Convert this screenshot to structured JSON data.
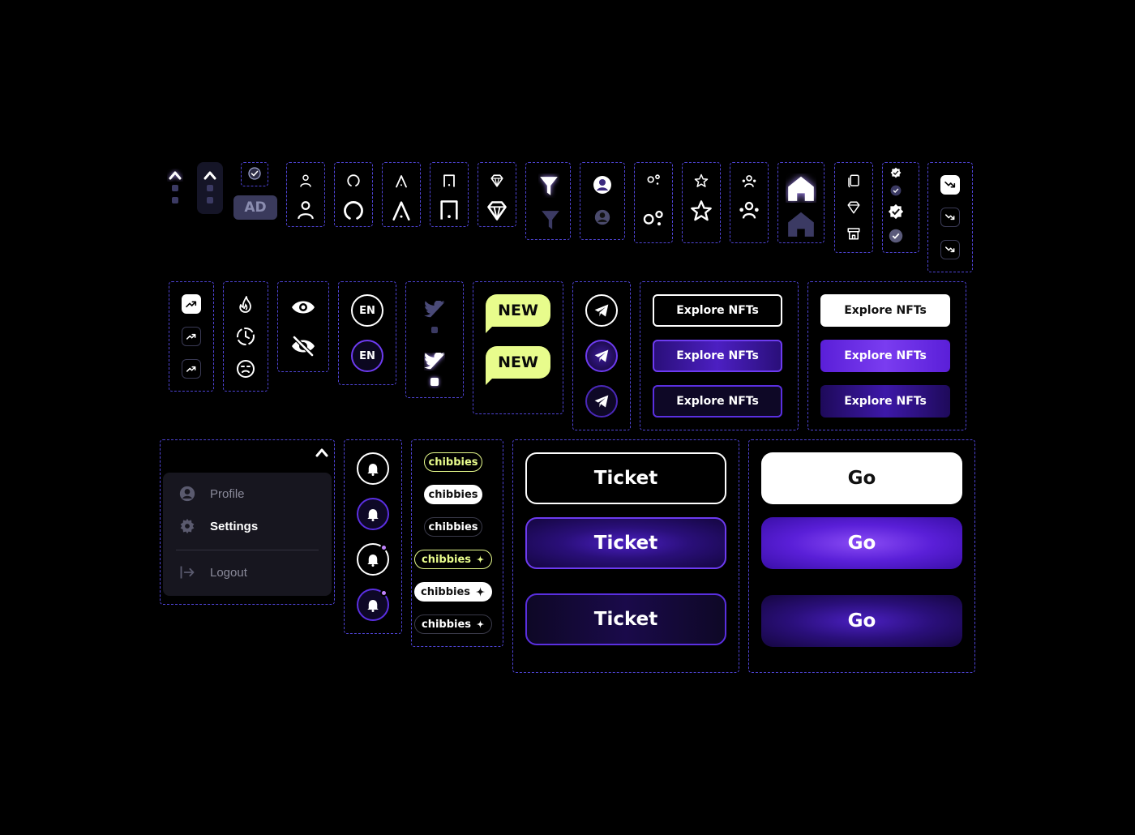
{
  "ad_badge": "AD",
  "language_label": "EN",
  "new_badge": "NEW",
  "explore_button": "Explore NFTs",
  "chip_label": "chibbies",
  "ticket_button": "Ticket",
  "go_button": "Go",
  "menu": {
    "items": [
      {
        "label": "Profile",
        "icon": "user-circle-icon"
      },
      {
        "label": "Settings",
        "icon": "gear-icon"
      },
      {
        "label": "Logout",
        "icon": "logout-icon"
      }
    ]
  },
  "colors": {
    "background": "#000000",
    "accent": "#6b21e8",
    "dash": "#4f44d6",
    "lime": "#e8fc8c",
    "muted": "#3b3a63"
  }
}
